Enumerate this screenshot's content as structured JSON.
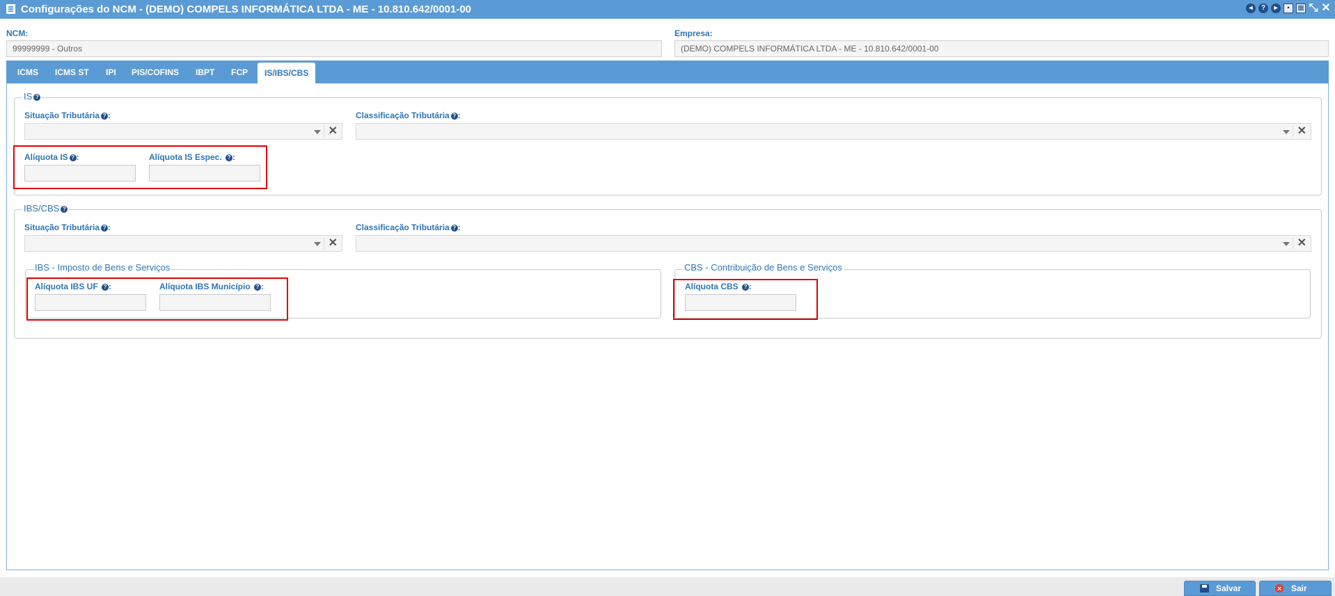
{
  "window": {
    "title": "Configurações do NCM - (DEMO) COMPELS INFORMÁTICA LTDA - ME - 10.810.642/0001-00",
    "icons": [
      "back-icon",
      "help-icon",
      "play-icon",
      "print-icon",
      "calendar-icon",
      "fullscreen-icon",
      "close-icon"
    ]
  },
  "header": {
    "ncm_label": "NCM:",
    "ncm_value": "99999999 - Outros",
    "empresa_label": "Empresa:",
    "empresa_value": "(DEMO) COMPELS INFORMÁTICA LTDA - ME - 10.810.642/0001-00"
  },
  "tabs": [
    {
      "label": "ICMS"
    },
    {
      "label": "ICMS ST"
    },
    {
      "label": "IPI"
    },
    {
      "label": "PIS/COFINS"
    },
    {
      "label": "IBPT"
    },
    {
      "label": "FCP"
    },
    {
      "label": "IS/IBS/CBS",
      "active": true
    }
  ],
  "is_section": {
    "legend": "IS",
    "situacao_label": "Situação Tributária",
    "classificacao_label": "Classificação Tributária",
    "aliquota_is_label": "Alíquota IS",
    "aliquota_is_espec_label": "Alíquota IS Espec.",
    "aliquota_is_value": "",
    "aliquota_is_espec_value": ""
  },
  "ibscbs_section": {
    "legend": "IBS/CBS",
    "situacao_label": "Situação Tributária",
    "classificacao_label": "Classificação Tributária",
    "ibs": {
      "legend": "IBS - Imposto de Bens e Serviços",
      "aliquota_uf_label": "Alíquota IBS UF",
      "aliquota_municipio_label": "Alíquota IBS Município",
      "aliquota_uf_value": "",
      "aliquota_municipio_value": ""
    },
    "cbs": {
      "legend": "CBS - Contribuição de Bens e Serviços",
      "aliquota_cbs_label": "Alíquota CBS",
      "aliquota_cbs_value": ""
    }
  },
  "footer": {
    "save_label": "Salvar",
    "exit_label": "Sair"
  },
  "colors": {
    "header_blue": "#5b9bd5",
    "label_blue": "#2e75b6",
    "highlight_red": "#e00000"
  }
}
